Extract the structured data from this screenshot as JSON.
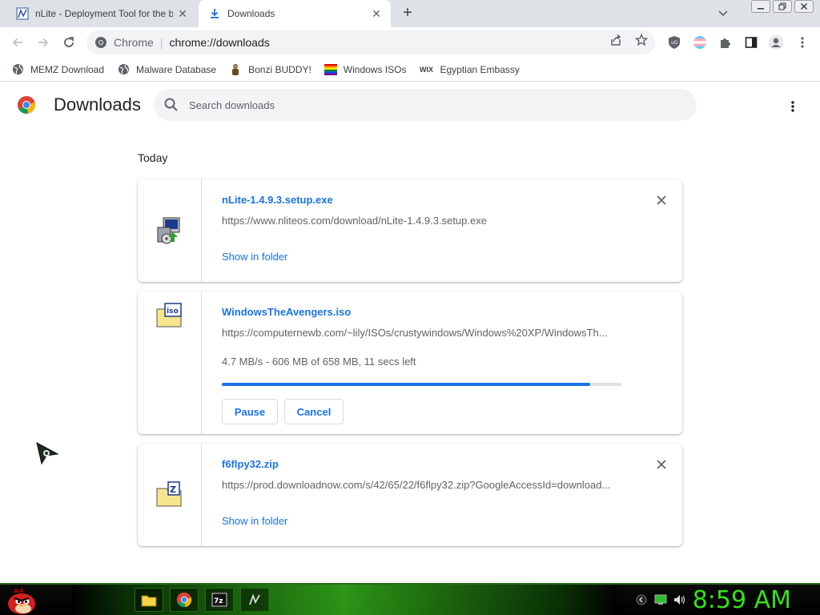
{
  "browser": {
    "tabs": [
      {
        "title": "nLite - Deployment Tool for the b",
        "active": false
      },
      {
        "title": "Downloads",
        "active": true
      }
    ],
    "omnibox": {
      "chip": "Chrome",
      "url": "chrome://downloads"
    },
    "bookmarks": [
      {
        "label": "MEMZ Download",
        "icon": "globe-icon"
      },
      {
        "label": "Malware Database",
        "icon": "globe-icon"
      },
      {
        "label": "Bonzi BUDDY!",
        "icon": "bonzi-icon"
      },
      {
        "label": "Windows ISOs",
        "icon": "windows-flag-icon"
      },
      {
        "label": "Egyptian Embassy",
        "icon": "wix-icon"
      }
    ]
  },
  "downloads_page": {
    "title": "Downloads",
    "search_placeholder": "Search downloads",
    "section_label": "Today",
    "items": [
      {
        "filename": "nLite-1.4.9.3.setup.exe",
        "url": "https://www.nliteos.com/download/nLite-1.4.9.3.setup.exe",
        "action": "Show in folder",
        "icon": "installer-icon"
      },
      {
        "filename": "WindowsTheAvengers.iso",
        "url": "https://computernewb.com/~lily/ISOs/crustywindows/Windows%20XP/WindowsTh...",
        "status": "4.7 MB/s - 606 MB of 658 MB, 11 secs left",
        "progress": 0.921,
        "pause_label": "Pause",
        "cancel_label": "Cancel",
        "icon": "iso-file-icon"
      },
      {
        "filename": "f6flpy32.zip",
        "url": "https://prod.downloadnow.com/s/42/65/22/f6flpy32.zip?GoogleAccessId=download...",
        "action": "Show in folder",
        "icon": "zip-file-icon"
      }
    ]
  },
  "taskbar": {
    "clock": "8:59 AM",
    "accent": "#35e11a"
  },
  "colors": {
    "link": "#1a73e8",
    "secondary_text": "#5f6368"
  }
}
